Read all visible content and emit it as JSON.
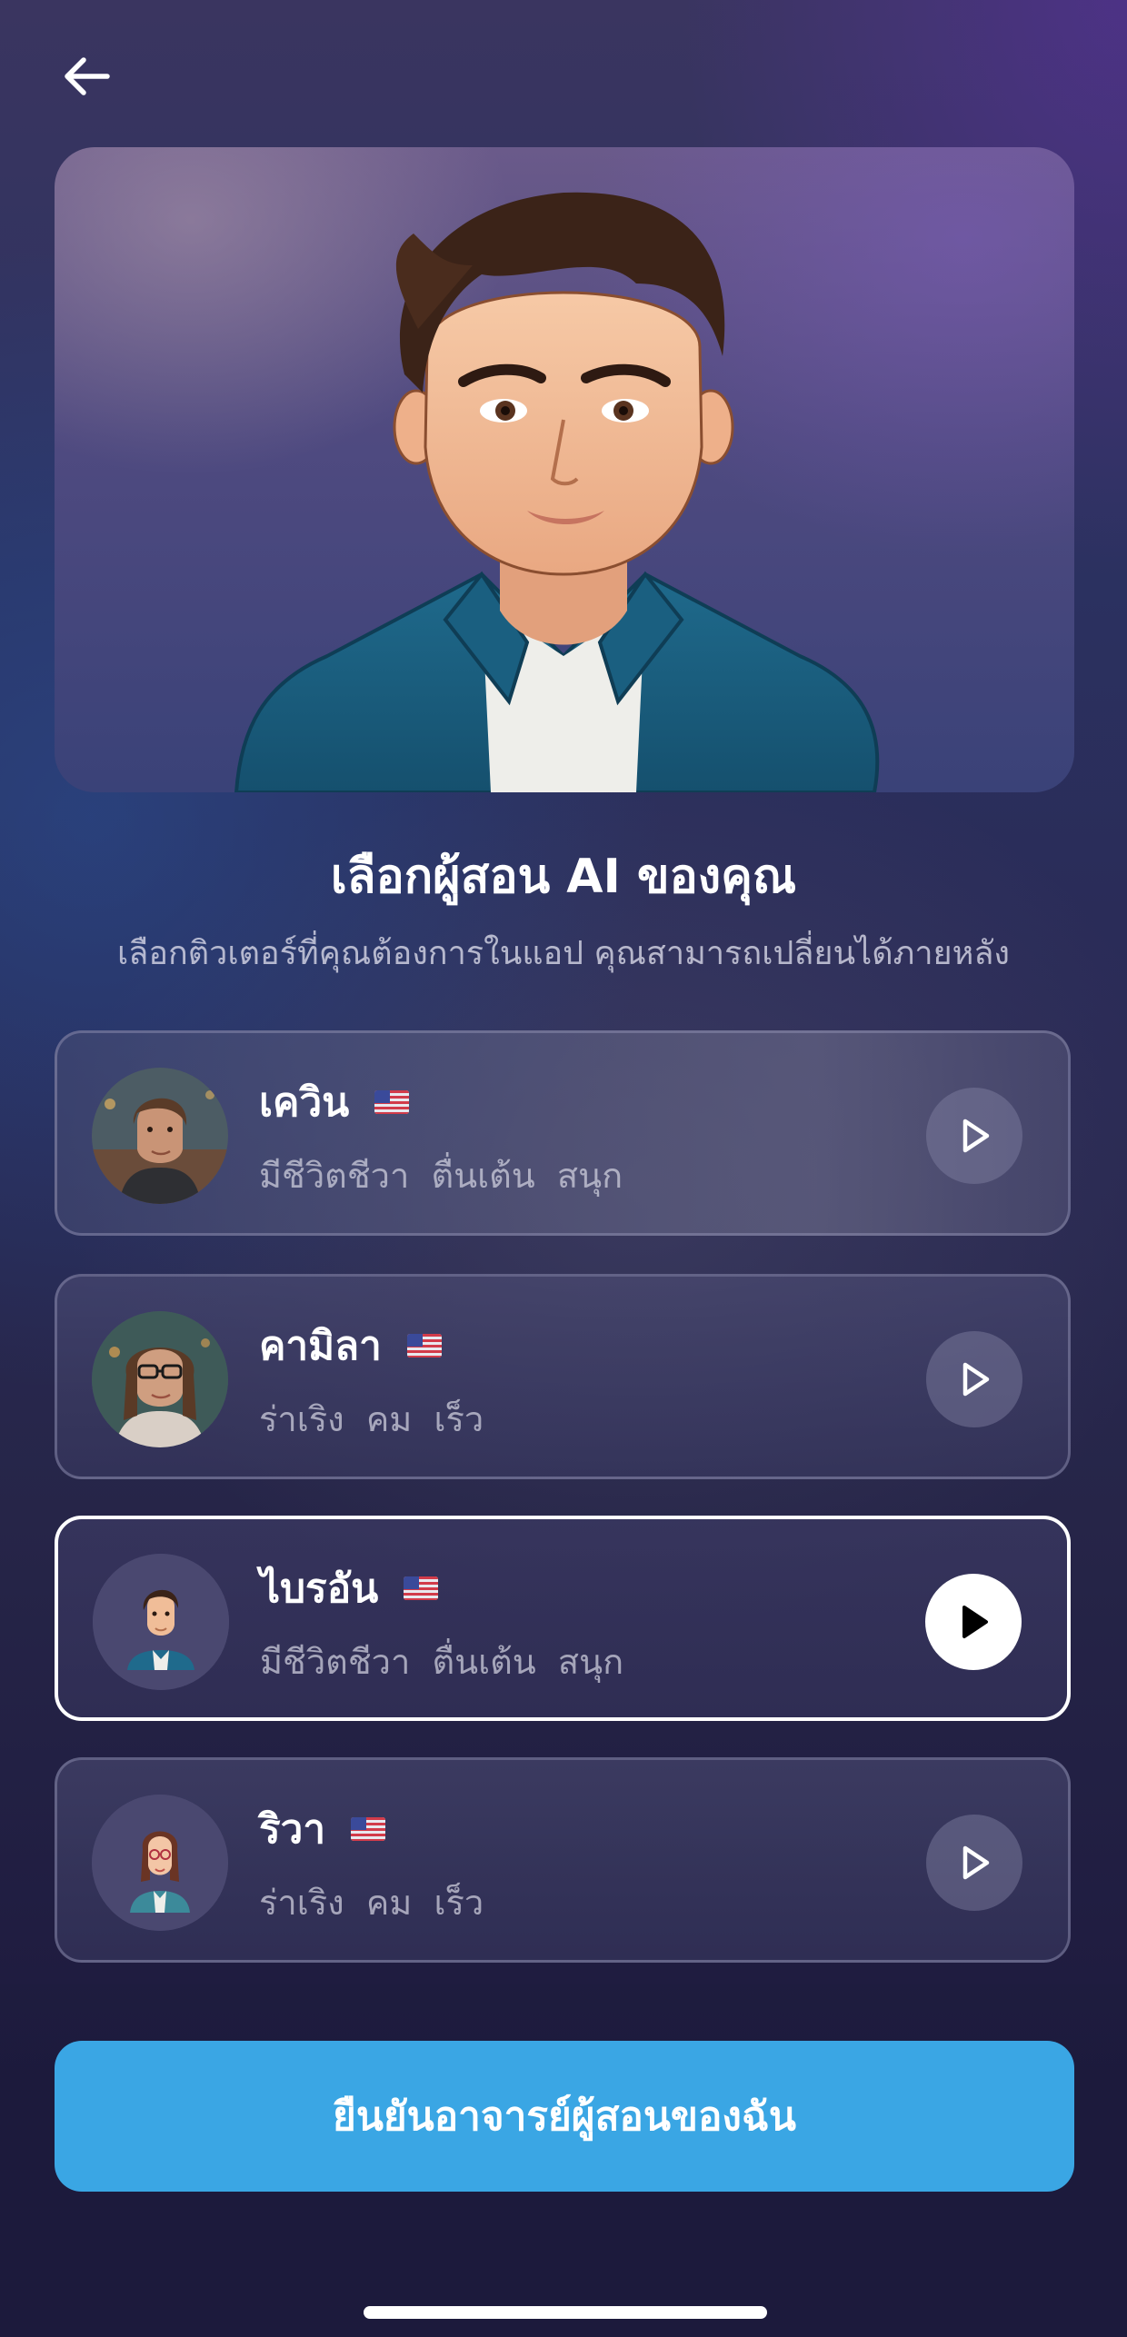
{
  "header": {
    "back_icon": "arrow-left-icon"
  },
  "hero": {
    "avatar": "selected-tutor-portrait"
  },
  "page": {
    "title": "เลือกผู้สอน AI ของคุณ",
    "subtitle": "เลือกติวเตอร์ที่คุณต้องการในแอป คุณสามารถเปลี่ยนได้ภายหลัง"
  },
  "tutors": [
    {
      "name": "เควิน",
      "traits": "มีชีวิตชีวา  ตื่นเต้น  สนุก",
      "flag": "us-flag-icon",
      "selected": false
    },
    {
      "name": "คามิลา",
      "traits": "ร่าเริง  คม  เร็ว",
      "flag": "us-flag-icon",
      "selected": false
    },
    {
      "name": "ไบรอัน",
      "traits": "มีชีวิตชีวา  ตื่นเต้น  สนุก",
      "flag": "us-flag-icon",
      "selected": true
    },
    {
      "name": "ริวา",
      "traits": "ร่าเริง  คม  เร็ว",
      "flag": "us-flag-icon",
      "selected": false
    }
  ],
  "confirm": {
    "label": "ยืนยันอาจารย์ผู้สอนของฉัน"
  },
  "colors": {
    "accent": "#3aa6e4",
    "selected_border": "#ffffff"
  }
}
